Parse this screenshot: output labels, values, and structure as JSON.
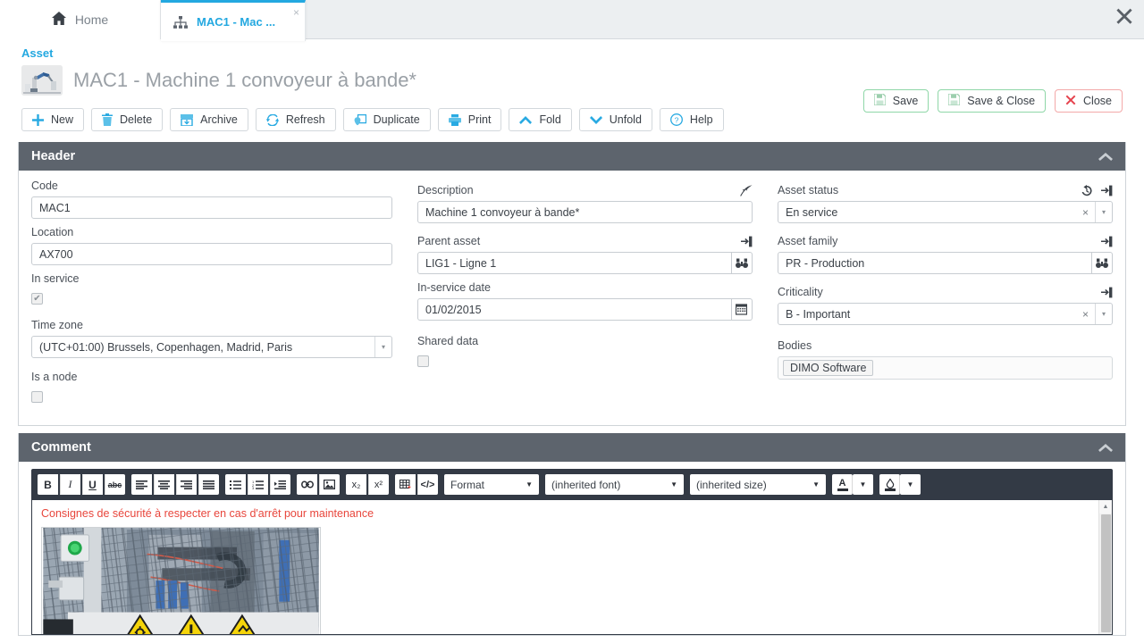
{
  "window": {
    "close_label": "✖"
  },
  "tabs": [
    {
      "label": "Home",
      "icon": "home-icon",
      "active": false
    },
    {
      "label": "MAC1 - Mac ...",
      "icon": "tree-icon",
      "active": true,
      "close_label": "×"
    }
  ],
  "page": {
    "breadcrumb": "Asset",
    "title": "MAC1 - Machine 1 convoyeur à bande*",
    "thumb_icon": "asset-thumbnail"
  },
  "head_actions": [
    {
      "label": "Save",
      "icon": "floppy-disk-icon",
      "style": "green"
    },
    {
      "label": "Save & Close",
      "icon": "floppy-disk-icon",
      "style": "green"
    },
    {
      "label": "Close",
      "icon": "x-mark-icon",
      "style": "red"
    }
  ],
  "toolbar": [
    {
      "label": "New",
      "icon": "plus-icon"
    },
    {
      "label": "Delete",
      "icon": "trash-icon"
    },
    {
      "label": "Archive",
      "icon": "archive-box-icon"
    },
    {
      "label": "Refresh",
      "icon": "refresh-icon"
    },
    {
      "label": "Duplicate",
      "icon": "duplicate-icon"
    },
    {
      "label": "Print",
      "icon": "printer-icon"
    },
    {
      "label": "Fold",
      "icon": "chevron-up-icon"
    },
    {
      "label": "Unfold",
      "icon": "chevron-down-icon"
    },
    {
      "label": "Help",
      "icon": "question-circle-icon"
    }
  ],
  "header_panel": {
    "title": "Header",
    "collapse_icon": "chevron-up-icon",
    "fields": {
      "code": {
        "label": "Code",
        "value": "MAC1"
      },
      "location": {
        "label": "Location",
        "value": "AX700"
      },
      "in_service": {
        "label": "In service",
        "checked": true
      },
      "time_zone": {
        "label": "Time zone",
        "value": "(UTC+01:00) Brussels, Copenhagen, Madrid, Paris"
      },
      "is_a_node": {
        "label": "Is a node",
        "checked": false
      },
      "description": {
        "label": "Description",
        "value": "Machine 1 convoyeur à bande*",
        "icon": "quill-pen-icon"
      },
      "parent_asset": {
        "label": "Parent asset",
        "value": "LIG1 - Ligne 1",
        "icon": "open-link-icon",
        "button_icon": "binoculars-icon"
      },
      "in_service_date": {
        "label": "In-service date",
        "value": "01/02/2015",
        "button_icon": "calendar-icon"
      },
      "shared_data": {
        "label": "Shared data",
        "checked": false
      },
      "asset_status": {
        "label": "Asset status",
        "value": "En service",
        "icons": [
          "history-icon",
          "open-link-icon"
        ],
        "clear_label": "×",
        "arrow_label": "▾"
      },
      "asset_family": {
        "label": "Asset family",
        "value": "PR - Production",
        "icon": "open-link-icon",
        "button_icon": "binoculars-icon"
      },
      "criticality": {
        "label": "Criticality",
        "value": "B - Important",
        "icon": "open-link-icon",
        "clear_label": "×",
        "arrow_label": "▾"
      },
      "bodies": {
        "label": "Bodies",
        "chip": "DIMO Software"
      }
    }
  },
  "comment_panel": {
    "title": "Comment",
    "collapse_icon": "chevron-up-icon",
    "editor": {
      "buttons": [
        {
          "name": "bold-icon",
          "label": "B"
        },
        {
          "name": "italic-icon",
          "label": "I"
        },
        {
          "name": "underline-icon",
          "label": "U"
        },
        {
          "name": "strikethrough-icon",
          "label": "abc"
        },
        {
          "name": "align-left-icon",
          "label": ""
        },
        {
          "name": "align-center-icon",
          "label": ""
        },
        {
          "name": "align-right-icon",
          "label": ""
        },
        {
          "name": "align-justify-icon",
          "label": ""
        },
        {
          "name": "bulleted-list-icon",
          "label": ""
        },
        {
          "name": "numbered-list-icon",
          "label": ""
        },
        {
          "name": "indent-icon",
          "label": ""
        },
        {
          "name": "link-icon",
          "label": ""
        },
        {
          "name": "image-icon",
          "label": ""
        },
        {
          "name": "subscript-icon",
          "label": "x₂"
        },
        {
          "name": "superscript-icon",
          "label": "x²"
        },
        {
          "name": "insert-table-icon",
          "label": ""
        },
        {
          "name": "source-code-icon",
          "label": "</>"
        }
      ],
      "selects": [
        {
          "name": "format-select",
          "label": "Format"
        },
        {
          "name": "font-select",
          "label": "(inherited font)"
        },
        {
          "name": "size-select",
          "label": "(inherited size)"
        }
      ],
      "color_buttons": [
        {
          "name": "text-color-icon",
          "label": "A",
          "arrow": "▾",
          "color": "#e8463c"
        },
        {
          "name": "background-color-icon",
          "label": "",
          "arrow": "▾",
          "color": "#29aae2"
        }
      ],
      "content": {
        "text": "Consignes de sécurité à respecter en cas d'arrêt pour maintenance",
        "text_color": "#e8463c",
        "image_alt": "industrial-machine-safety-photo"
      },
      "scrollbar": {
        "up_label": "▲"
      }
    }
  },
  "colors": {
    "accent": "#23a8e0",
    "panel_header": "#5d646d",
    "editor_toolbar": "#333a45",
    "danger": "#e5424d",
    "success_border": "#8fd7a8"
  }
}
